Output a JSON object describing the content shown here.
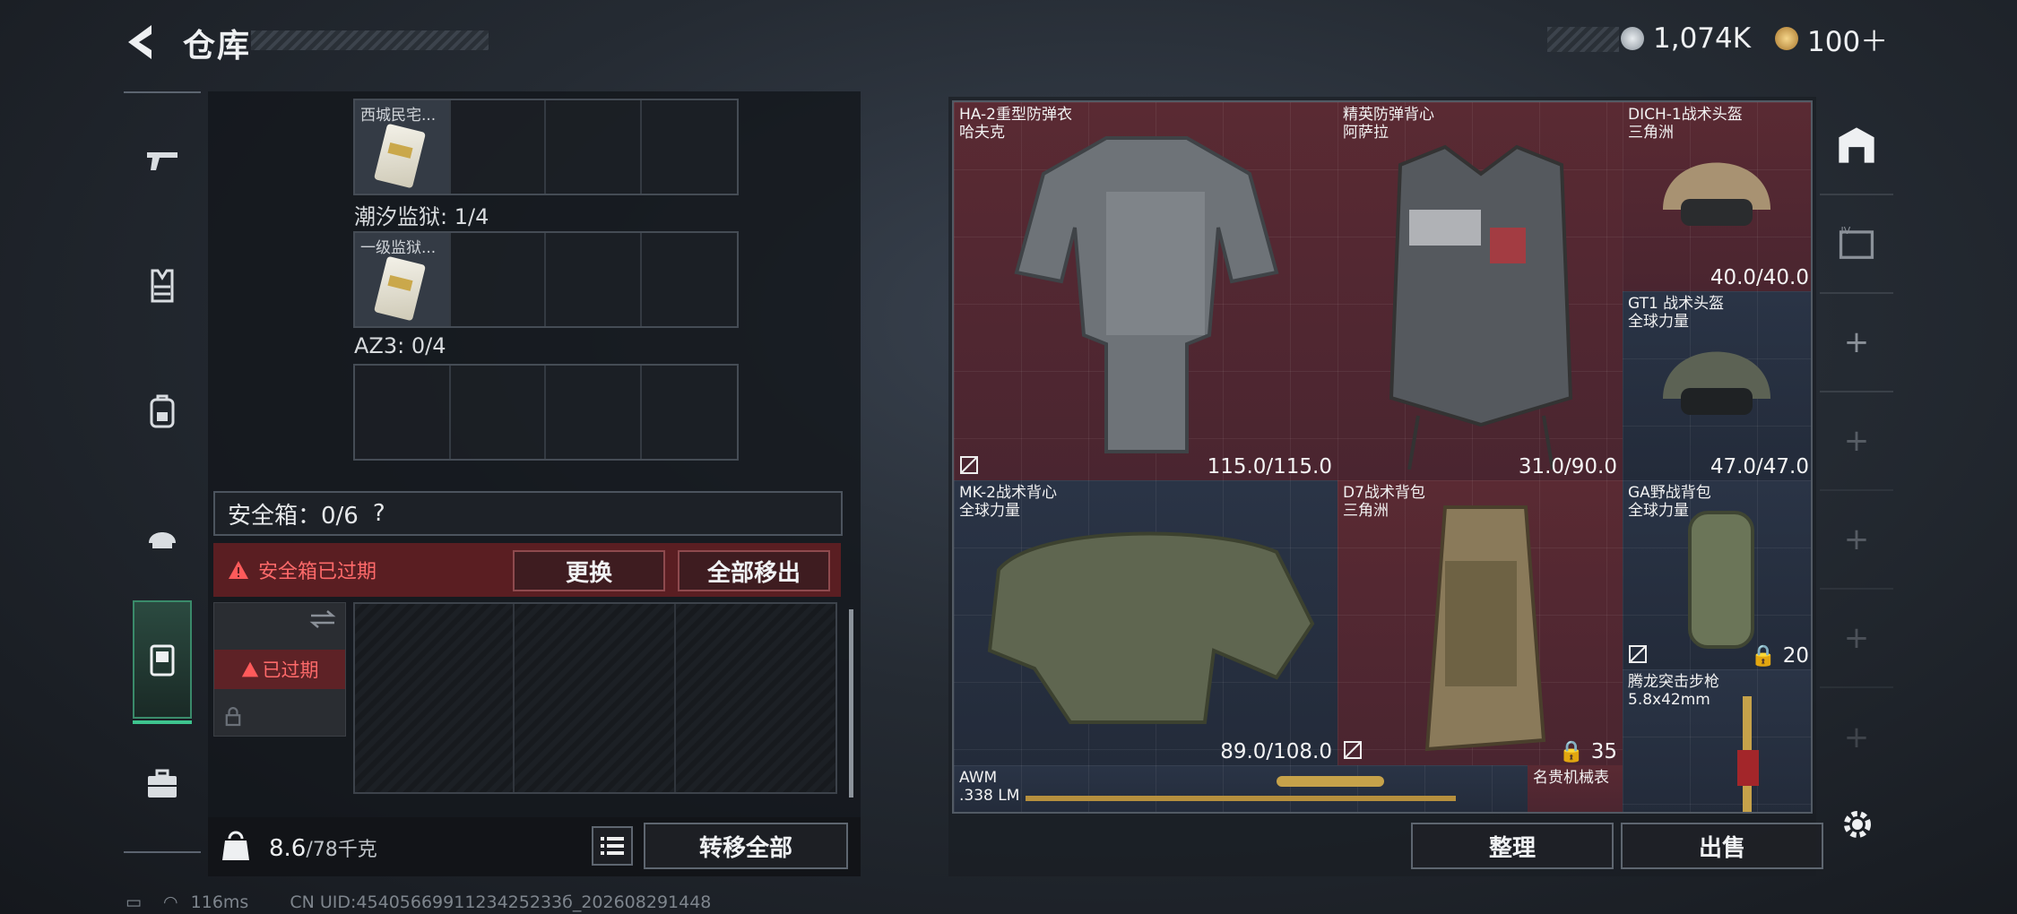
{
  "header": {
    "title": "仓库",
    "currency": [
      {
        "icon": "silver-coin-icon",
        "value": "1,074K",
        "color": "#c4ccd4"
      },
      {
        "icon": "gold-coin-icon",
        "value": "100＋",
        "color": "#d8a54a"
      }
    ]
  },
  "left_nav": {
    "items": [
      {
        "icon": "pistol-icon",
        "active": false
      },
      {
        "icon": "vest-icon",
        "active": false
      },
      {
        "icon": "backpack-icon",
        "active": false
      },
      {
        "icon": "helmet-icon",
        "active": false
      },
      {
        "icon": "safe-box-icon",
        "active": true
      },
      {
        "icon": "briefcase-icon",
        "active": false
      }
    ]
  },
  "key_area": {
    "sections": [
      {
        "label": "",
        "card": "西城民宅..."
      },
      {
        "label": "潮汐监狱: 1/4",
        "card": "一级监狱..."
      },
      {
        "label": "AZ3: 0/4",
        "card": ""
      }
    ]
  },
  "safe": {
    "label": "安全箱：0/6",
    "help": "?",
    "expired_warning": "安全箱已过期",
    "replace_button": "更换",
    "remove_all_button": "全部移出",
    "slot_expired": "已过期"
  },
  "bottom": {
    "weight_value": "8.6",
    "weight_capacity": "/78千克",
    "list_icon": "list-icon",
    "transfer_all_button": "转移全部"
  },
  "items": [
    {
      "name": "HA-2重型防弹衣",
      "brand": "哈夫克",
      "durability": "115.0/115.0",
      "bg": "red"
    },
    {
      "name": "精英防弹背心",
      "brand": "阿萨拉",
      "durability": "31.0/90.0",
      "bg": "red"
    },
    {
      "name": "DICH-1战术头盔",
      "brand": "三角洲",
      "durability": "40.0/40.0",
      "bg": "red"
    },
    {
      "name": "GT1 战术头盔",
      "brand": "全球力量",
      "durability": "47.0/47.0",
      "bg": "blue"
    },
    {
      "name": "MK-2战术背心",
      "brand": "全球力量",
      "durability": "89.0/108.0",
      "bg": "blue"
    },
    {
      "name": "D7战术背包",
      "brand": "三角洲",
      "capacity": "35",
      "bg": "red"
    },
    {
      "name": "GA野战背包",
      "brand": "全球力量",
      "capacity": "20",
      "bg": "blue"
    },
    {
      "name": "腾龙突击步枪",
      "brand": "5.8x42mm",
      "bg": "blue"
    },
    {
      "name": "AWM",
      "brand": ".338 LM",
      "bg": "blue"
    },
    {
      "name": "名贵机械表",
      "brand": "",
      "bg": "red"
    }
  ],
  "actions": {
    "sort_button": "整理",
    "sell_button": "出售"
  },
  "status": {
    "ping": "116ms",
    "uid": "CN UID:4540566991123425233б_202608291448"
  }
}
